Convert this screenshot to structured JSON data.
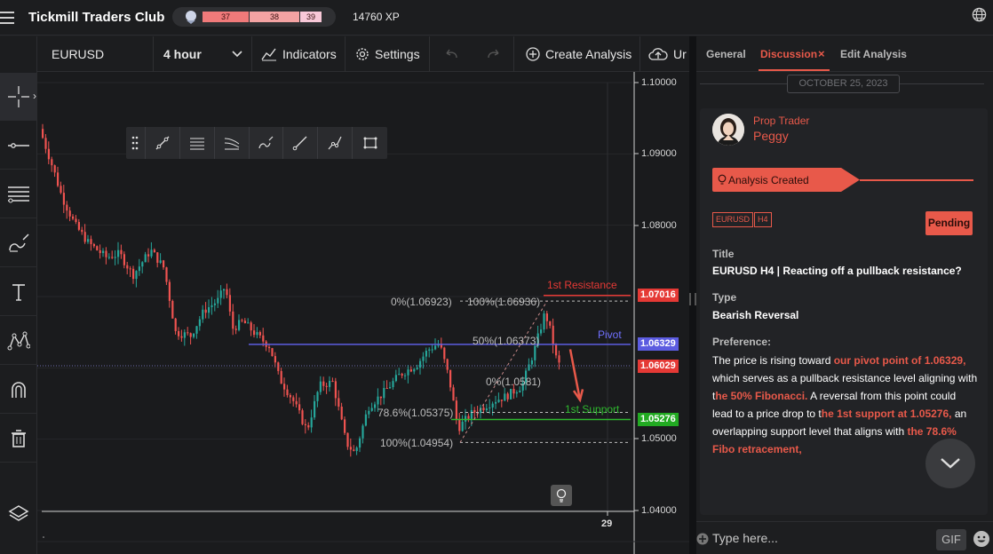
{
  "app": {
    "title": "Tickmill Traders Club",
    "level_segments": [
      "37",
      "38",
      "39"
    ],
    "xp": "14760 XP"
  },
  "chart_toolbar": {
    "symbol": "EURUSD",
    "timeframe": "4 hour",
    "indicators": "Indicators",
    "settings": "Settings",
    "create_analysis": "Create Analysis",
    "upload_partial": "Ur"
  },
  "left_tools": [
    "crosshair-icon",
    "horizontal-line-icon",
    "fib-levels-icon",
    "brush-icon",
    "text-icon",
    "pattern-icon",
    "magnet-icon",
    "trash-icon",
    "layers-icon"
  ],
  "chart": {
    "y_axis_labels": [
      "1.10000",
      "1.09000",
      "1.08000",
      "1.05000",
      "1.04000"
    ],
    "x_axis_label": "29",
    "price_flags": {
      "resistance": "1.07016",
      "pivot": "1.06329",
      "current": "1.06029",
      "support": "1.05276"
    },
    "line_labels": {
      "resistance": "1st Resistance",
      "pivot": "Pivot",
      "support": "1st Support"
    },
    "fib_labels": {
      "left_top": "0%(1.06923)",
      "right_top": "100%(1.06936)",
      "mid50": "50%(1.06373)",
      "right_zero": "0%(1.0581)",
      "f786": "78.6%(1.05375)",
      "f100": "100%(1.04954)"
    },
    "colors": {
      "up": "#26a69a",
      "down": "#ef5350",
      "resistance": "#e53935",
      "pivot": "#5c5ce0",
      "support": "#2eb82e",
      "accent": "#e8594a"
    }
  },
  "panel": {
    "tabs": {
      "general": "General",
      "discussion": "Discussion",
      "close": "×",
      "edit": "Edit Analysis"
    },
    "date": "OCTOBER 25, 2023",
    "author_role": "Prop Trader",
    "author_name": "Peggy",
    "status_banner": "Analysis Created",
    "tags": [
      "EURUSD",
      "H4"
    ],
    "status": "Pending",
    "title_label": "Title",
    "title_value": "EURUSD H4 | Reacting off a pullback resistance?",
    "type_label": "Type",
    "type_value": "Bearish Reversal",
    "pref_label": "Preference:",
    "pref_text": [
      {
        "t": "The price is rising toward ",
        "h": false
      },
      {
        "t": "our pivot point of 1.06329,",
        "h": true
      },
      {
        "t": " which serves as a pullback resistance level aligning with t",
        "h": false
      },
      {
        "t": "he 50% Fibonacci.",
        "h": true
      },
      {
        "t": " A reversal from this point could lead to a price drop to t",
        "h": false
      },
      {
        "t": "he 1st support at 1.05276,",
        "h": true
      },
      {
        "t": " an overlapping support level that aligns with ",
        "h": false
      },
      {
        "t": "the 78.6% Fibo retracement,",
        "h": true
      }
    ],
    "composer_placeholder": "Type here...",
    "gif": "GIF"
  }
}
